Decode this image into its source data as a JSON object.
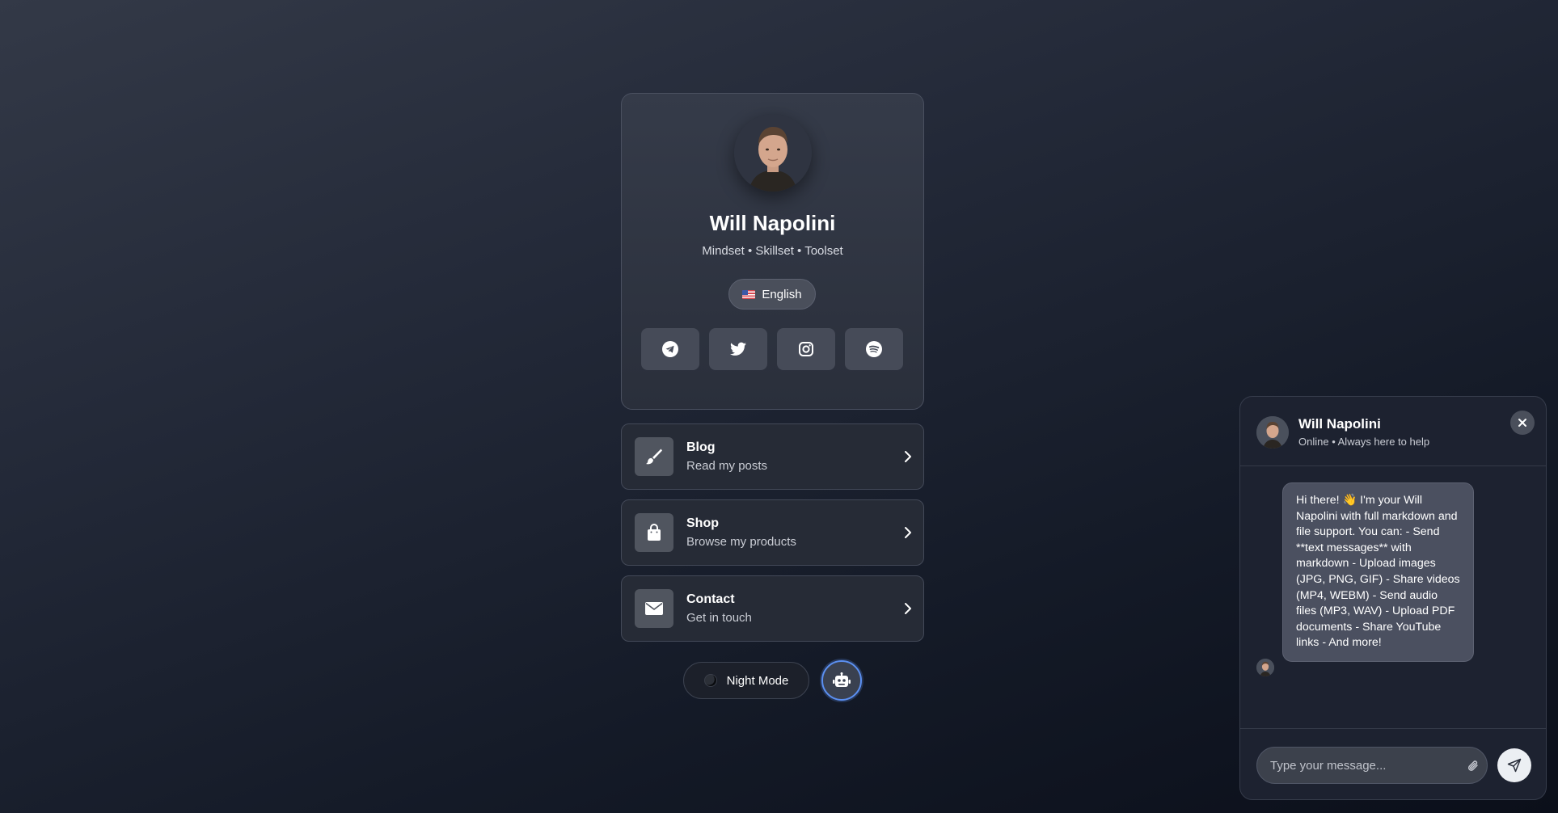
{
  "profile": {
    "name": "Will Napolini",
    "tagline": "Mindset • Skillset • Toolset",
    "language": "English",
    "socials": [
      {
        "icon": "telegram-icon"
      },
      {
        "icon": "twitter-icon"
      },
      {
        "icon": "instagram-icon"
      },
      {
        "icon": "spotify-icon"
      }
    ]
  },
  "links": [
    {
      "title": "Blog",
      "subtitle": "Read my posts",
      "icon": "brush-icon"
    },
    {
      "title": "Shop",
      "subtitle": "Browse my products",
      "icon": "shopping-bag-icon"
    },
    {
      "title": "Contact",
      "subtitle": "Get in touch",
      "icon": "envelope-icon"
    }
  ],
  "controls": {
    "night_mode_label": "Night Mode",
    "chatbot_icon": "robot-icon"
  },
  "chat": {
    "name": "Will Napolini",
    "status": "Online • Always here to help",
    "message": "Hi there! 👋 I'm your Will Napolini with full markdown and file support. You can: - Send **text messages** with markdown - Upload images (JPG, PNG, GIF) - Share videos (MP4, WEBM) - Send audio files (MP3, WAV) - Upload PDF documents - Share YouTube links - And more!",
    "input_placeholder": "Type your message..."
  },
  "colors": {
    "accent_ring": "#5b8ff0",
    "card_bg": "#2a2f3b",
    "bubble_bg": "#4b5060"
  }
}
